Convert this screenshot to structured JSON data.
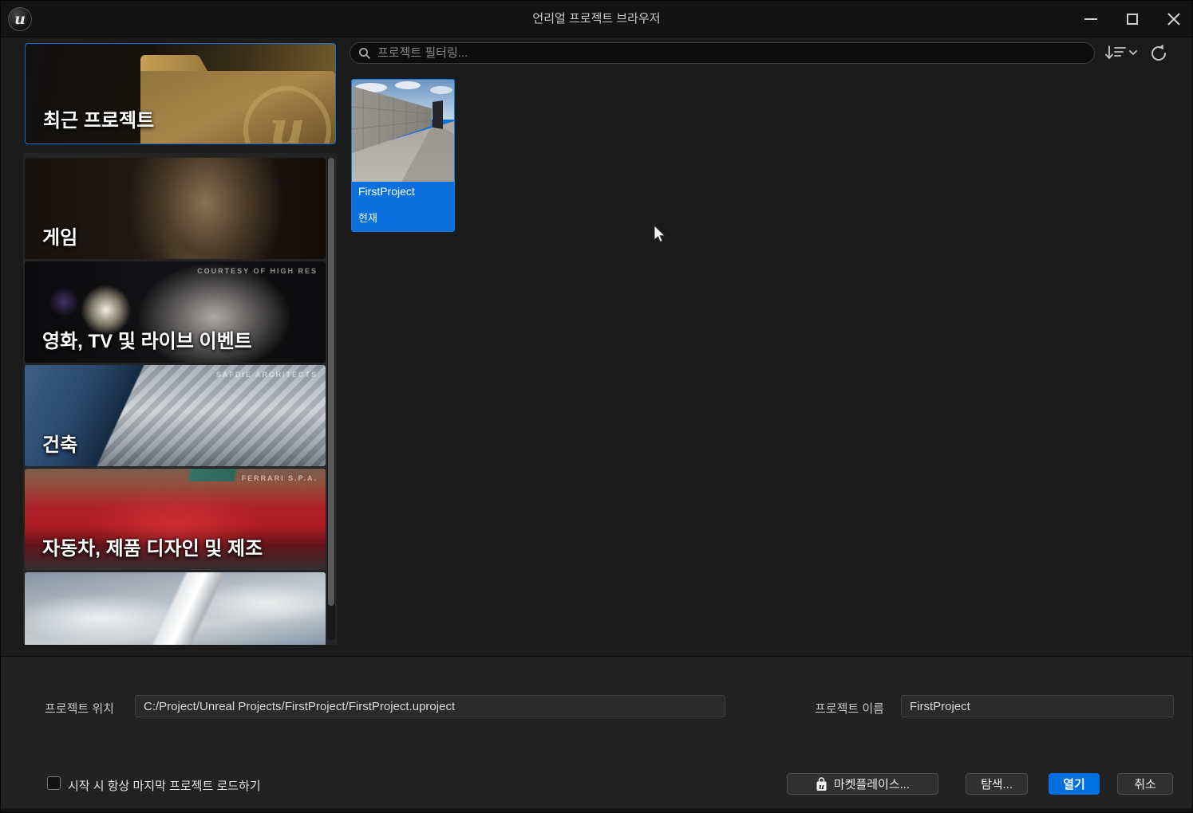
{
  "window": {
    "title": "언리얼 프로젝트 브라우저"
  },
  "sidebar": {
    "recent_label": "최근 프로젝트",
    "categories": [
      {
        "label": "게임",
        "credit": ""
      },
      {
        "label": "영화, TV 및 라이브 이벤트",
        "credit": "COURTESY OF HIGH RES"
      },
      {
        "label": "건축",
        "credit": "SAFDIE ARCHITECTS"
      },
      {
        "label": "자동차, 제품 디자인 및 제조",
        "credit": "FERRARI S.P.A."
      },
      {
        "label": "",
        "credit": ""
      }
    ]
  },
  "search": {
    "placeholder": "프로젝트 필터링..."
  },
  "project": {
    "name": "FirstProject",
    "status": "현재"
  },
  "footer": {
    "location_label": "프로젝트 위치",
    "location_value": "C:/Project/Unreal Projects/FirstProject/FirstProject.uproject",
    "name_label": "프로젝트 이름",
    "name_value": "FirstProject",
    "autoload_label": "시작 시 항상 마지막 프로젝트 로드하기",
    "marketplace_button": "마켓플레이스...",
    "browse_button": "탐색...",
    "open_button": "열기",
    "cancel_button": "취소"
  },
  "colors": {
    "accent_blue": "#0070e0",
    "folder_gold": "#a8854a"
  }
}
